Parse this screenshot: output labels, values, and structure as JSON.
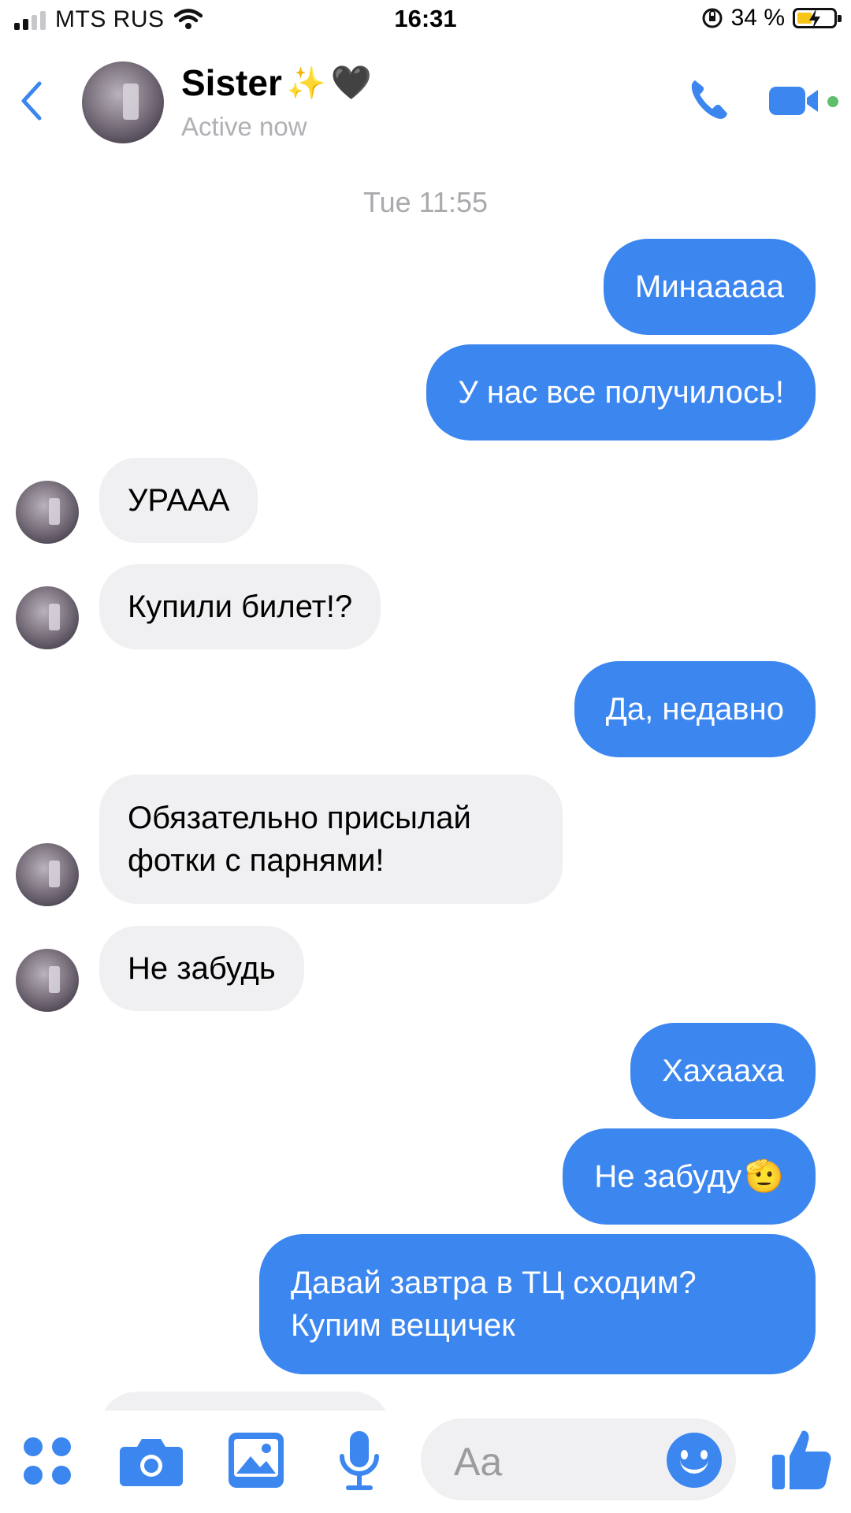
{
  "status_bar": {
    "carrier": "MTS RUS",
    "time": "16:31",
    "battery_pct": "34 %"
  },
  "header": {
    "name": "Sister",
    "name_emoji": "✨",
    "name_heart": "🖤",
    "status": "Active now",
    "icons": [
      "back-chevron-icon",
      "phone-icon",
      "video-camera-icon"
    ],
    "accent_color": "#3c86ef",
    "online_color": "#5fbf6c"
  },
  "conversation": {
    "date_label": "Tue 11:55",
    "messages": [
      {
        "from": "me",
        "text": "Минаааaa"
      },
      {
        "from": "me",
        "text": "У нас все получилось!"
      },
      {
        "from": "them",
        "text": "УРААА"
      },
      {
        "from": "them",
        "text": "Купили билет!?"
      },
      {
        "from": "me",
        "text": "Да, недавно"
      },
      {
        "from": "them",
        "text": "Обязательно присылай фотки с парнями!"
      },
      {
        "from": "them",
        "text": "Не забудь"
      },
      {
        "from": "me",
        "text": "Хахааха"
      },
      {
        "from": "me",
        "text": "Не забуду",
        "emoji": "🫡"
      },
      {
        "from": "me",
        "text": "Давай завтра в ТЦ сходим? Купим вещичек"
      }
    ]
  },
  "composer": {
    "placeholder": "Aa",
    "icons": [
      "apps-grid-icon",
      "camera-icon",
      "gallery-icon",
      "microphone-icon",
      "emoji-icon",
      "thumbs-up-icon"
    ]
  }
}
